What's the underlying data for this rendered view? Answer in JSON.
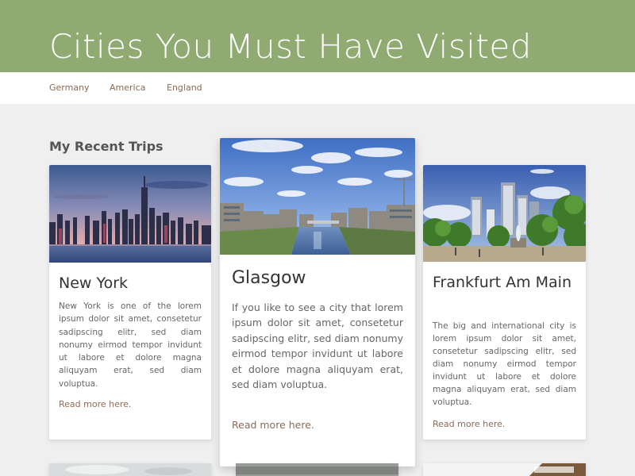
{
  "header": {
    "title": "Cities You Must Have Visited",
    "color": "#8fab72"
  },
  "nav": {
    "items": [
      {
        "label": "Germany"
      },
      {
        "label": "America"
      },
      {
        "label": "England"
      }
    ]
  },
  "section": {
    "title": "My Recent Trips"
  },
  "cards": [
    {
      "title": "New York",
      "body": "New York is one of the lorem ipsum dolor sit amet, consetetur sadipscing elitr, sed diam nonumy eirmod tempor invidunt ut labore et dolore magna aliquyam erat, sed diam voluptua.",
      "link": "Read more here.",
      "image": "new-york-skyline-photo"
    },
    {
      "title": "Glasgow",
      "body": "If you like to see a city that lorem ipsum dolor sit amet, consetetur sadipscing elitr, sed diam nonumy eirmod tempor invidunt ut labore et dolore magna aliquyam erat, sed diam voluptua.",
      "link": "Read more here.",
      "image": "glasgow-river-photo"
    },
    {
      "title": "Frankfurt Am Main",
      "body": "The big and international city is lorem ipsum dolor sit amet, consetetur sadipscing elitr, sed diam nonumy eirmod tempor invidunt ut labore et dolore magna aliquyam erat, sed diam voluptua.",
      "link": "Read more here.",
      "image": "frankfurt-park-photo"
    }
  ],
  "colors": {
    "link": "#8a6a55",
    "background": "#efefef"
  }
}
